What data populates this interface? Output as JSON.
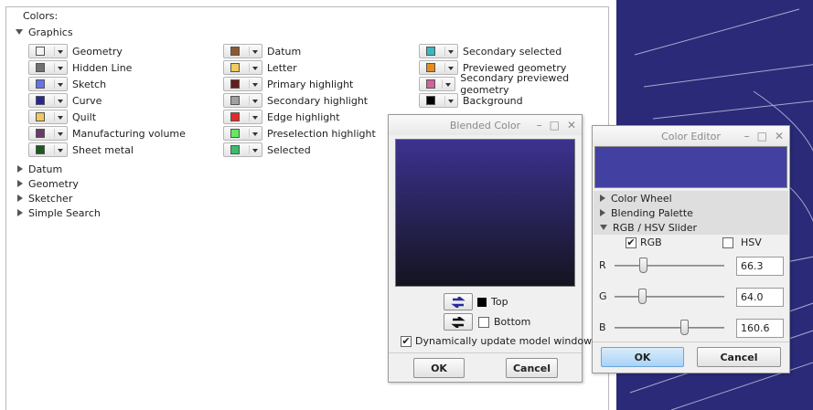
{
  "panel": {
    "colors_label": "Colors:",
    "graphics_label": "Graphics",
    "collapsed": [
      {
        "label": "Datum"
      },
      {
        "label": "Geometry"
      },
      {
        "label": "Sketcher"
      },
      {
        "label": "Simple Search"
      }
    ],
    "columns": [
      [
        {
          "label": "Geometry",
          "color": "#f4f4f4"
        },
        {
          "label": "Hidden Line",
          "color": "#707070"
        },
        {
          "label": "Sketch",
          "color": "#6474e8"
        },
        {
          "label": "Curve",
          "color": "#26269a"
        },
        {
          "label": "Quilt",
          "color": "#f2c85a"
        },
        {
          "label": "Manufacturing volume",
          "color": "#6c3a6a"
        },
        {
          "label": "Sheet metal",
          "color": "#1c5a1c"
        }
      ],
      [
        {
          "label": "Datum",
          "color": "#8c5a32"
        },
        {
          "label": "Letter",
          "color": "#f2cc60"
        },
        {
          "label": "Primary highlight",
          "color": "#6a1a1a"
        },
        {
          "label": "Secondary highlight",
          "color": "#a0a0a0"
        },
        {
          "label": "Edge highlight",
          "color": "#e82828"
        },
        {
          "label": "Preselection highlight",
          "color": "#64e864"
        },
        {
          "label": "Selected",
          "color": "#3cbc6c"
        }
      ],
      [
        {
          "label": "Secondary selected",
          "color": "#3ab8c0"
        },
        {
          "label": "Previewed geometry",
          "color": "#e88c1c"
        },
        {
          "label": "Secondary previewed geometry",
          "color": "#d2609a"
        },
        {
          "label": "Background",
          "color": "#000000"
        }
      ]
    ]
  },
  "blended": {
    "title": "Blended Color",
    "gradient_top": "#3c3290",
    "gradient_bottom": "#141420",
    "top_label": "Top",
    "bottom_label": "Bottom",
    "dynamic_label": "Dynamically update model window",
    "ok": "OK",
    "cancel": "Cancel"
  },
  "editor": {
    "title": "Color Editor",
    "preview_color": "#4240a0",
    "sections": [
      "Color Wheel",
      "Blending Palette",
      "RGB / HSV Slider"
    ],
    "rgb_label": "RGB",
    "hsv_label": "HSV",
    "sliders": [
      {
        "label": "R",
        "value": "66.3",
        "fraction": 0.26
      },
      {
        "label": "G",
        "value": "64.0",
        "fraction": 0.25
      },
      {
        "label": "B",
        "value": "160.6",
        "fraction": 0.63
      }
    ],
    "ok": "OK",
    "cancel": "Cancel"
  },
  "viewport": {
    "background": "#2a2a78"
  }
}
